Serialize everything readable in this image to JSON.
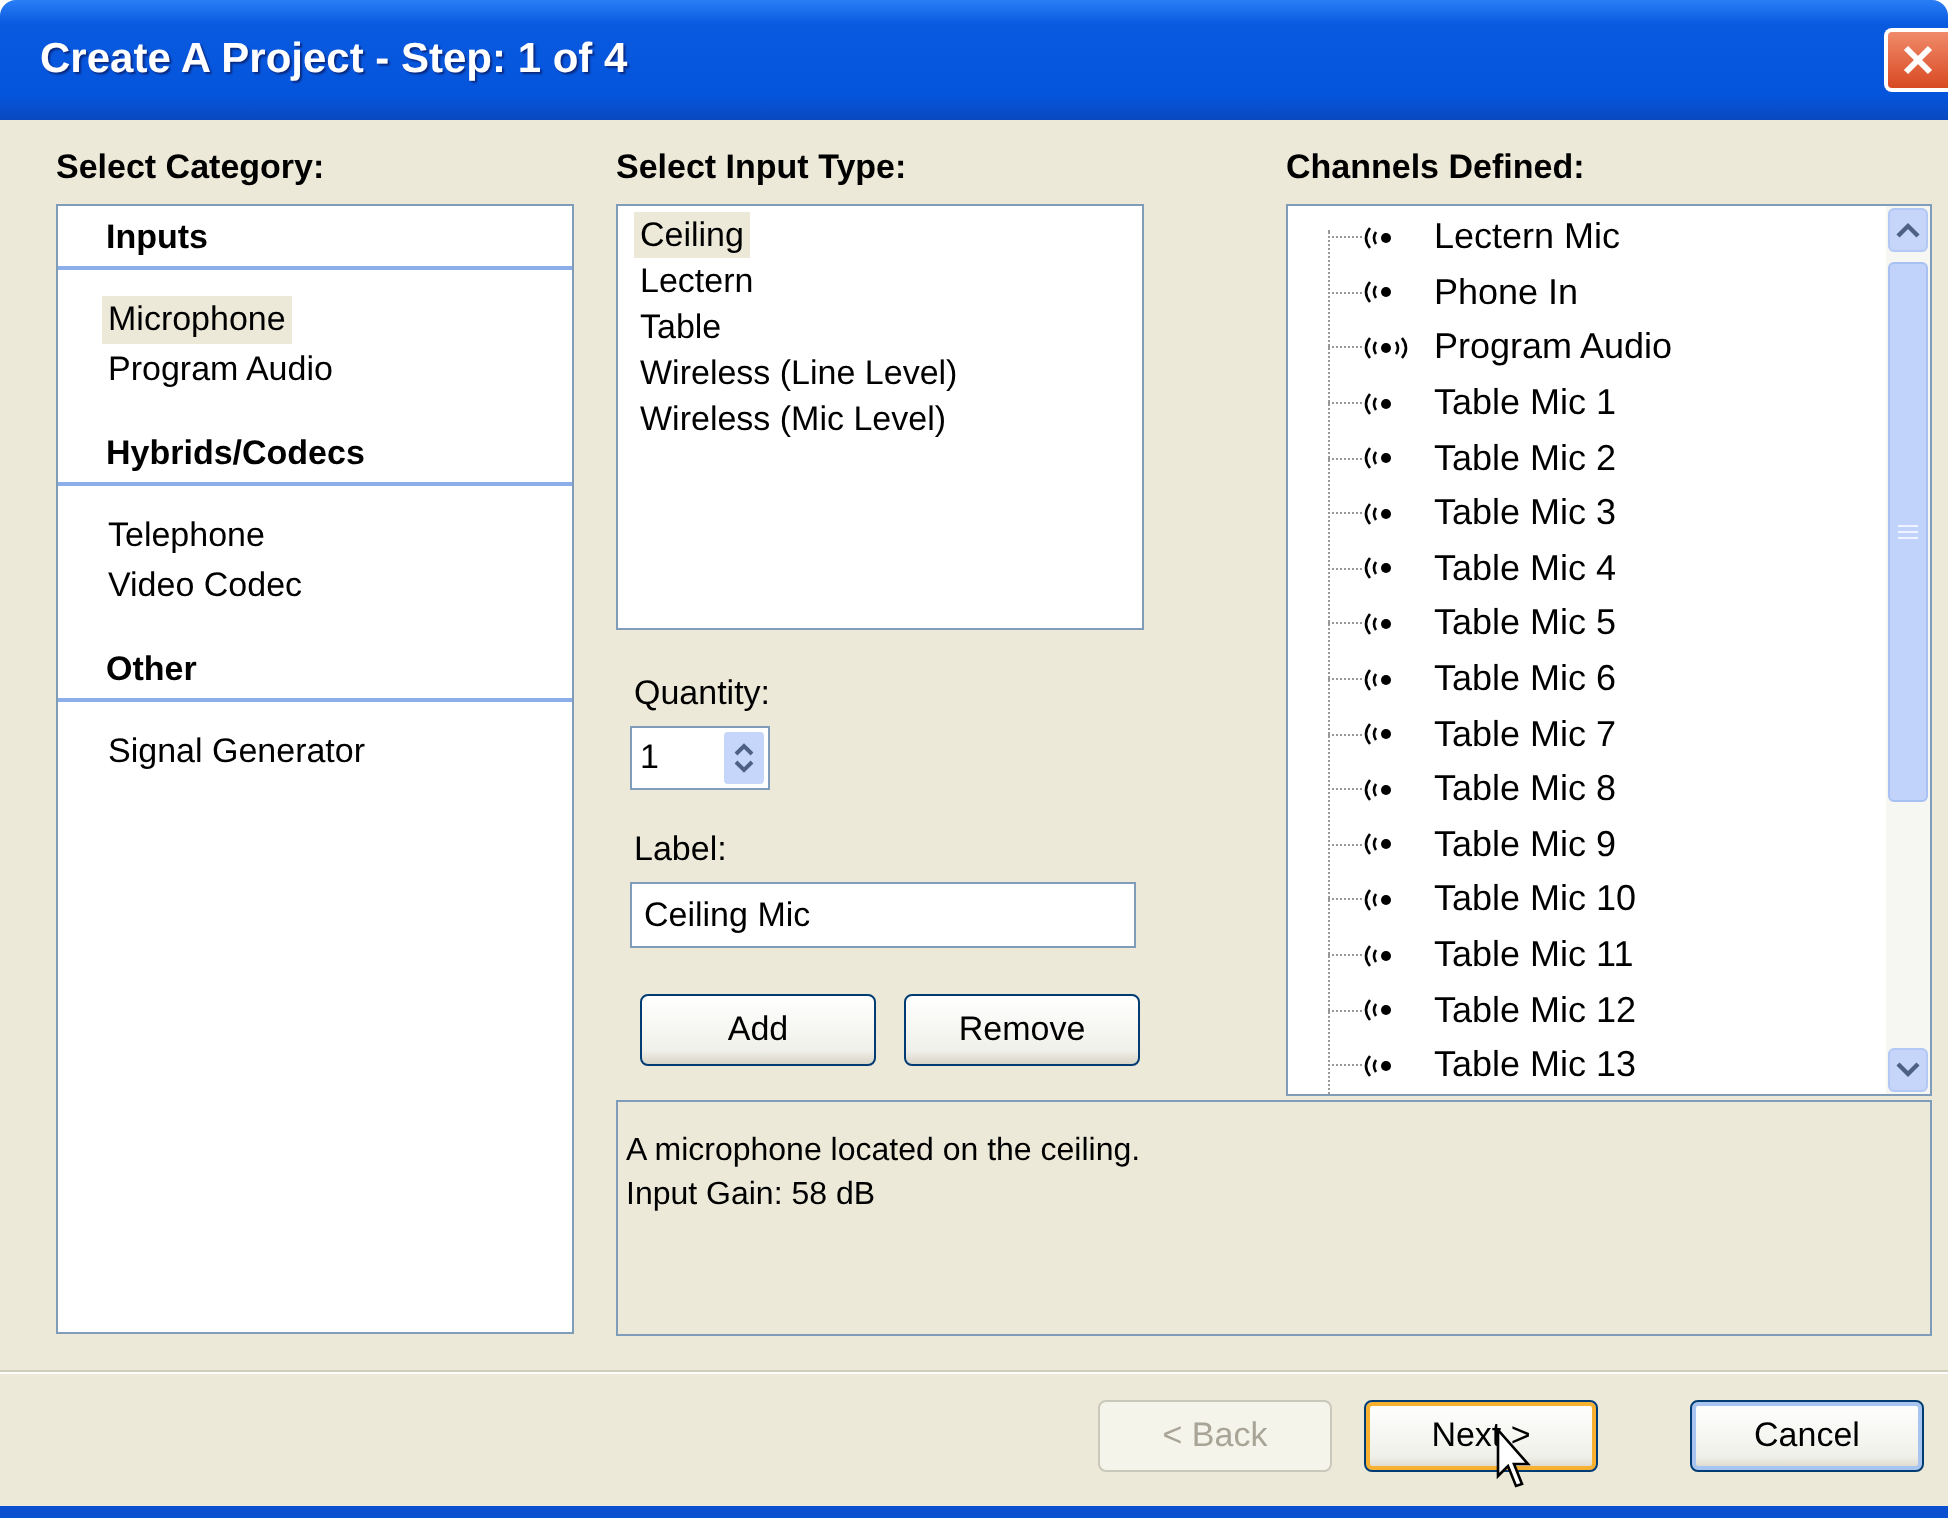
{
  "window": {
    "title": "Create A Project - Step: 1 of 4"
  },
  "category": {
    "heading": "Select Category:",
    "groups": [
      {
        "title": "Inputs",
        "items": [
          {
            "label": "Microphone",
            "selected": true
          },
          {
            "label": "Program Audio",
            "selected": false
          }
        ]
      },
      {
        "title": "Hybrids/Codecs",
        "items": [
          {
            "label": "Telephone",
            "selected": false
          },
          {
            "label": "Video Codec",
            "selected": false
          }
        ]
      },
      {
        "title": "Other",
        "items": [
          {
            "label": "Signal Generator",
            "selected": false
          }
        ]
      }
    ]
  },
  "input_type": {
    "heading": "Select Input Type:",
    "items": [
      {
        "label": "Ceiling",
        "selected": true
      },
      {
        "label": "Lectern",
        "selected": false
      },
      {
        "label": "Table",
        "selected": false
      },
      {
        "label": "Wireless (Line Level)",
        "selected": false
      },
      {
        "label": "Wireless (Mic Level)",
        "selected": false
      }
    ]
  },
  "quantity": {
    "label": "Quantity:",
    "value": "1"
  },
  "label_field": {
    "label": "Label:",
    "value": "Ceiling Mic"
  },
  "actions": [
    {
      "label": "Add"
    },
    {
      "label": "Remove"
    }
  ],
  "channels": {
    "heading": "Channels Defined:",
    "items": [
      {
        "label": "Lectern Mic",
        "kind": "mono"
      },
      {
        "label": "Phone In",
        "kind": "mono"
      },
      {
        "label": "Program Audio",
        "kind": "stereo"
      },
      {
        "label": "Table Mic 1",
        "kind": "mono"
      },
      {
        "label": "Table Mic 2",
        "kind": "mono"
      },
      {
        "label": "Table Mic 3",
        "kind": "mono"
      },
      {
        "label": "Table Mic 4",
        "kind": "mono"
      },
      {
        "label": "Table Mic 5",
        "kind": "mono"
      },
      {
        "label": "Table Mic 6",
        "kind": "mono"
      },
      {
        "label": "Table Mic 7",
        "kind": "mono"
      },
      {
        "label": "Table Mic 8",
        "kind": "mono"
      },
      {
        "label": "Table Mic 9",
        "kind": "mono"
      },
      {
        "label": "Table Mic 10",
        "kind": "mono"
      },
      {
        "label": "Table Mic 11",
        "kind": "mono"
      },
      {
        "label": "Table Mic 12",
        "kind": "mono"
      },
      {
        "label": "Table Mic 13",
        "kind": "mono"
      }
    ]
  },
  "description": [
    "A microphone located on the ceiling.",
    "Input Gain: 58 dB"
  ],
  "footer_buttons": [
    {
      "label": "< Back",
      "disabled": true,
      "highlighted": false
    },
    {
      "label": "Next >",
      "disabled": false,
      "highlighted": true
    },
    {
      "label": "Cancel",
      "disabled": false,
      "highlighted": false
    }
  ]
}
